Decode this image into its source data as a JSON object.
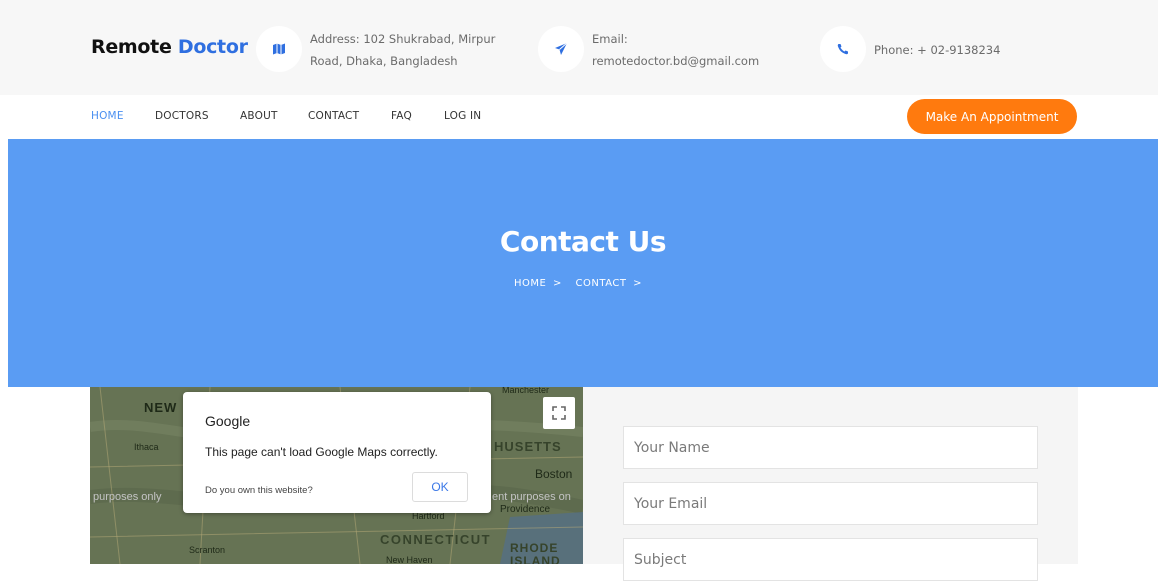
{
  "brand": {
    "name_part1": "Remote",
    "name_part2": "Doctor",
    "accent_color": "#2f6fe0"
  },
  "contact_info": {
    "address_icon": "map-icon",
    "address_line1": "Address: 102 Shukrabad, Mirpur",
    "address_line2": "Road, Dhaka, Bangladesh",
    "email_icon": "paper-plane-icon",
    "email_label": "Email:",
    "email_value": "remotedoctor.bd@gmail.com",
    "phone_icon": "phone-icon",
    "phone_text": "Phone: + 02-9138234"
  },
  "nav": {
    "items": [
      {
        "label": "HOME",
        "active": true
      },
      {
        "label": "DOCTORS",
        "active": false
      },
      {
        "label": "ABOUT",
        "active": false
      },
      {
        "label": "CONTACT",
        "active": false
      },
      {
        "label": "FAQ",
        "active": false
      },
      {
        "label": "LOG IN",
        "active": false
      }
    ],
    "cta_label": "Make An Appointment",
    "cta_color": "#ff7a0e"
  },
  "hero": {
    "title": "Contact Us",
    "breadcrumb": [
      "HOME",
      ">",
      "CONTACT",
      ">"
    ],
    "background": "#5a9cf3"
  },
  "map": {
    "labels": [
      "NEW",
      "Ithaca",
      "HUSETTS",
      "Boston",
      "purposes only",
      "ent purposes on",
      "Providence",
      "Hartford",
      "CONNECTICUT",
      "RHODE",
      "ISLAND",
      "Scranton",
      "New Haven",
      "Manchester"
    ],
    "dialog": {
      "brand": "Google",
      "message": "This page can't load Google Maps correctly.",
      "question": "Do you own this website?",
      "ok_label": "OK"
    },
    "fullscreen_icon": "fullscreen-icon"
  },
  "form": {
    "name_placeholder": "Your Name",
    "email_placeholder": "Your Email",
    "subject_placeholder": "Subject"
  }
}
